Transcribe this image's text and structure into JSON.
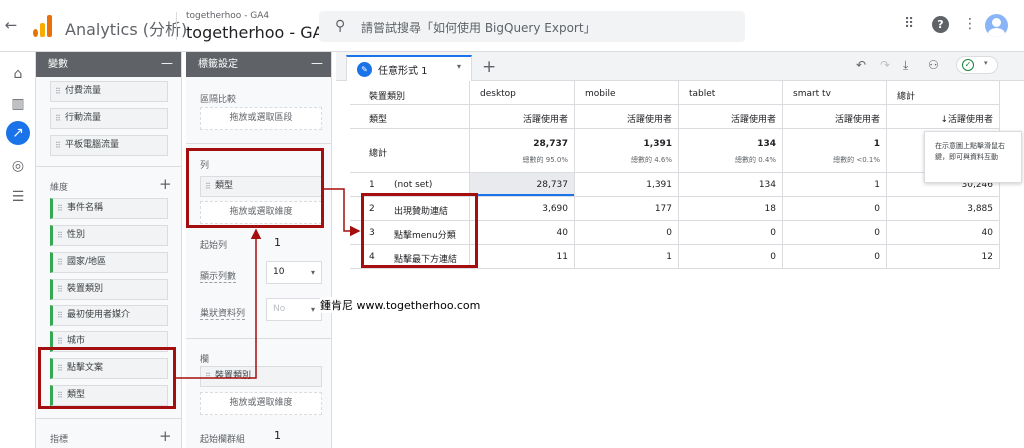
{
  "topbar": {
    "back_glyph": "←",
    "app_title": "Analytics (分析)",
    "account_small": "togetherhoo - GA4",
    "account_big": "togetherhoo - GA4",
    "search_placeholder": "請嘗試搜尋「如何使用 BigQuery Export」",
    "search_glyph": "⚲",
    "apps_glyph": "⠿",
    "help_glyph": "?",
    "more_glyph": "⋮",
    "icons": [
      "back-arrow-icon",
      "analytics-logo",
      "search-icon",
      "apps-grid-icon",
      "help-icon",
      "more-vert-icon",
      "avatar-icon"
    ]
  },
  "rail": {
    "items": [
      {
        "name": "home-icon",
        "glyph": "⌂"
      },
      {
        "name": "reports-icon",
        "glyph": "▥"
      },
      {
        "name": "explore-icon",
        "glyph": "↗"
      },
      {
        "name": "advertising-icon",
        "glyph": "◎"
      },
      {
        "name": "configure-icon",
        "glyph": "☰"
      }
    ]
  },
  "variables_panel": {
    "title": "變數",
    "minus_glyph": "—",
    "plus_glyph": "+",
    "grip_glyph": "⠿",
    "segments": [
      "付費流量",
      "行動流量",
      "平板電腦流量"
    ],
    "dimensions_label": "維度",
    "dimensions": [
      "事件名稱",
      "性別",
      "國家/地區",
      "裝置類別",
      "最初使用者媒介",
      "城市",
      "點擊文案",
      "類型"
    ],
    "metrics_label": "指標"
  },
  "tab_settings": {
    "title": "標籤設定",
    "segment_compare_label": "區隔比較",
    "drop_segment": "拖放或選取區段",
    "rows_label": "列",
    "row_chip": "類型",
    "drop_dimension": "拖放或選取維度",
    "start_row_label": "起始列",
    "start_row_value": "1",
    "show_rows_label": "顯示列數",
    "show_rows_value": "10",
    "nested_rows_label": "巢狀資料列",
    "nested_rows_value": "No",
    "columns_label": "欄",
    "column_chip": "裝置類別",
    "drop_dimension_2": "拖放或選取維度",
    "start_col_group_label": "起始欄群組",
    "start_col_group_value": "1",
    "dropdown_glyph": "▾"
  },
  "canvas": {
    "tab_label": "任意形式 1",
    "pencil_glyph": "✎",
    "tab_arrow": "▾",
    "add_tab": "+",
    "tools": [
      {
        "name": "undo-icon",
        "glyph": "↶"
      },
      {
        "name": "redo-icon",
        "glyph": "↷"
      },
      {
        "name": "download-icon",
        "glyph": "⤓"
      },
      {
        "name": "share-user-icon",
        "glyph": "⚇"
      }
    ],
    "status_glyph": "✓",
    "status_arrow": "▾"
  },
  "table": {
    "dim_header": "裝置類別",
    "row_dim_header": "類型",
    "columns": [
      "desktop",
      "mobile",
      "tablet",
      "smart tv",
      "總計"
    ],
    "metric_label": "活躍使用者",
    "sorted_metric_label": "↓活躍使用者",
    "total_label": "總計",
    "totals": [
      {
        "value": "28,737",
        "pct": "總數的 95.0%"
      },
      {
        "value": "1,391",
        "pct": "總數的 4.6%"
      },
      {
        "value": "134",
        "pct": "總數的 0.4%"
      },
      {
        "value": "1",
        "pct": "總數的 <0.1%"
      },
      {
        "value": "",
        "pct": ""
      }
    ],
    "rows": [
      {
        "idx": "1",
        "label": "(not set)",
        "values": [
          "28,737",
          "1,391",
          "134",
          "1",
          "30,246"
        ]
      },
      {
        "idx": "2",
        "label": "出現贊助連結",
        "values": [
          "3,690",
          "177",
          "18",
          "0",
          "3,885"
        ]
      },
      {
        "idx": "3",
        "label": "點擊menu分類",
        "values": [
          "40",
          "0",
          "0",
          "0",
          "40"
        ]
      },
      {
        "idx": "4",
        "label": "點擊最下方連結",
        "values": [
          "11",
          "1",
          "0",
          "0",
          "12"
        ]
      }
    ],
    "tooltip": "在示意圖上點擊滑鼠右鍵，即可與資料互動"
  },
  "annotation": {
    "text": "鍾肯尼  www.togetherhoo.com",
    "box_color": "#a50e0e"
  },
  "colors": {
    "accent": "#1a73e8",
    "chip_border": "#34a853",
    "panel_header": "#5f6368",
    "logo_orange": "#f9ab00"
  }
}
